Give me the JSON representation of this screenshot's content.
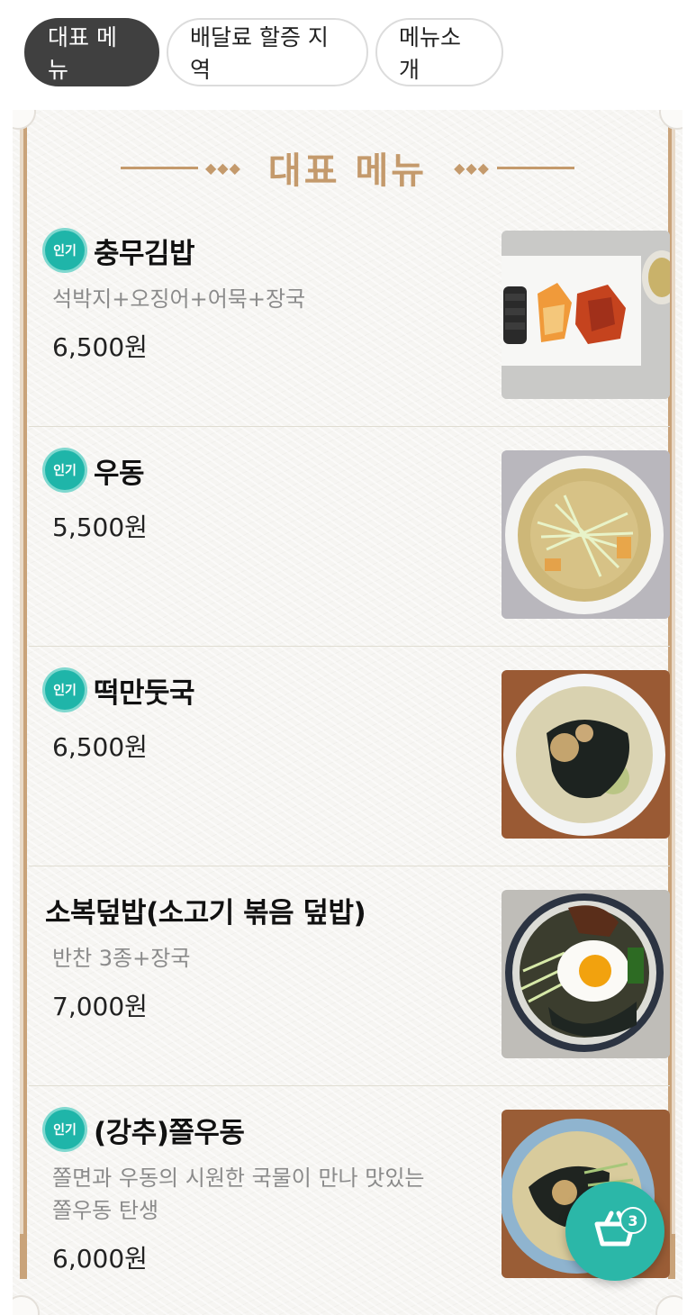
{
  "tabs": [
    {
      "label": "대표 메뉴",
      "active": true
    },
    {
      "label": "배달료 할증 지역",
      "active": false
    },
    {
      "label": "메뉴소개",
      "active": false
    }
  ],
  "section": {
    "title": "대표 메뉴"
  },
  "badge_label": "인기",
  "items": [
    {
      "name": "충무김밥",
      "popular": true,
      "desc": "석박지+오징어+어묵+장국",
      "price": "6,500원",
      "image": "chungmu-gimbap-photo"
    },
    {
      "name": "우동",
      "popular": true,
      "desc": "",
      "price": "5,500원",
      "image": "udon-photo"
    },
    {
      "name": "떡만둣국",
      "popular": true,
      "desc": "",
      "price": "6,500원",
      "image": "tteok-mandu-guk-photo"
    },
    {
      "name": "소복덮밥(소고기 볶음 덮밥)",
      "popular": false,
      "desc": "반찬 3종+장국",
      "price": "7,000원",
      "image": "beef-rice-bowl-photo"
    },
    {
      "name": "(강추)쫄우동",
      "popular": true,
      "desc": "쫄면과 우동의 시원한 국물이 만나 맛있는 쫄우동 탄생",
      "price": "6,000원",
      "image": "jjol-udon-photo"
    }
  ],
  "cart": {
    "count": "3",
    "icon": "cart-icon"
  },
  "colors": {
    "accent": "#2bb7a8",
    "badge": "#1fb5a9",
    "gold": "#c49a6c",
    "tab_active": "#404040"
  }
}
